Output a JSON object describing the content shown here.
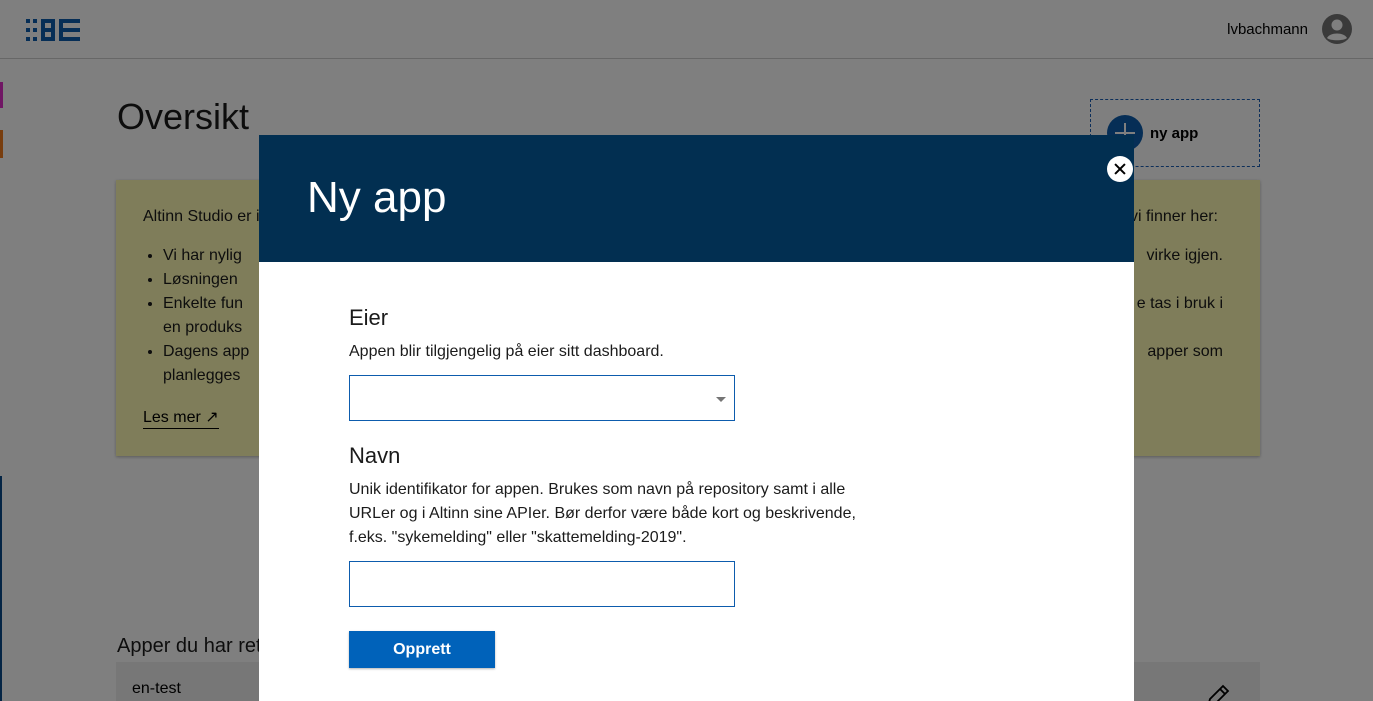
{
  "header": {
    "logo_icon": "altinn-studio-logo-icon",
    "username": "lvbachmann",
    "avatar_icon": "account-circle-icon"
  },
  "page": {
    "title": "Oversikt",
    "new_app_label": "ny app",
    "info": {
      "intro": "Altinn Studio er i",
      "intro_right": "vi finner her:",
      "items": [
        {
          "left": "Vi har nylig",
          "right": "virke igjen."
        },
        {
          "left": "Løsningen"
        },
        {
          "left": "Enkelte fun",
          "left2": "en produks",
          "right": "e tas i bruk i"
        },
        {
          "left": "Dagens app",
          "left2": "planlegges",
          "right": "apper som"
        }
      ],
      "read_more": "Les mer ↗"
    },
    "apps_heading": "Apper du har rett",
    "app_card_name": "en-test"
  },
  "modal": {
    "title": "Ny app",
    "owner_label": "Eier",
    "owner_desc": "Appen blir tilgjengelig på eier sitt dashboard.",
    "owner_value": "",
    "name_label": "Navn",
    "name_desc_1": "Unik identifikator for appen. Brukes som navn på repository samt i alle",
    "name_desc_2": "URLer og i Altinn sine APIer. Bør derfor være både kort og beskrivende,",
    "name_desc_3": "f.eks. \"sykemelding\" eller \"skattemelding-2019\".",
    "name_value": "",
    "create_label": "Opprett"
  },
  "colors": {
    "modal_header": "#022f51",
    "primary_button": "#0062ba",
    "info_box": "#fefbb5",
    "input_border": "#0d5cad"
  }
}
